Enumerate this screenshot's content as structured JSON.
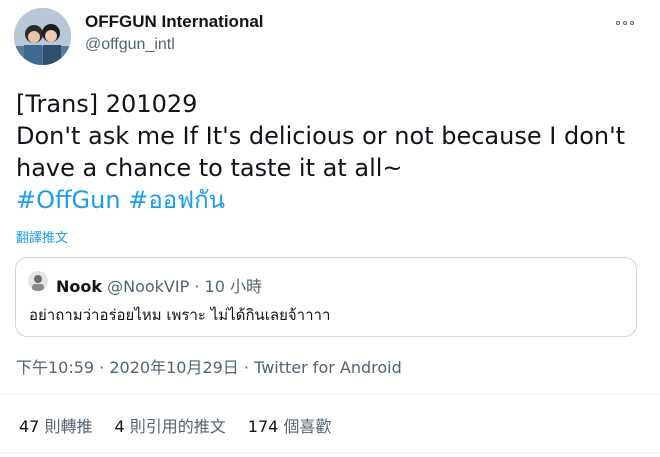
{
  "author": {
    "display_name": "OFFGUN International",
    "handle": "@offgun_intl",
    "avatar_icon": "profile-photo"
  },
  "more_icon": "more-horizontal-icon",
  "tweet": {
    "lines": [
      "[Trans] 201029",
      "Don't ask me If It's delicious or not because I don't",
      "have a chance to taste it at all~"
    ],
    "hashtags": [
      "#OffGun",
      "#ออฟกัน"
    ],
    "translate_label": "翻譯推文"
  },
  "quote": {
    "name": "Nook",
    "handle": "@NookVIP",
    "separator": "·",
    "time": "10 小時",
    "text": "อย่าถามว่าอร่อยไหม เพราะ ไม่ได้กินเลยจ้าาาา"
  },
  "meta": {
    "timestamp": "下午10:59 · 2020年10月29日",
    "separator": "·",
    "source": "Twitter for Android"
  },
  "stats": {
    "retweets_count": "47",
    "retweets_label": "則轉推",
    "quotes_count": "4",
    "quotes_label": "則引用的推文",
    "likes_count": "174",
    "likes_label": "個喜歡"
  },
  "colors": {
    "link": "#1d9bf0",
    "secondary_text": "#536471",
    "border": "#cfd9de"
  }
}
